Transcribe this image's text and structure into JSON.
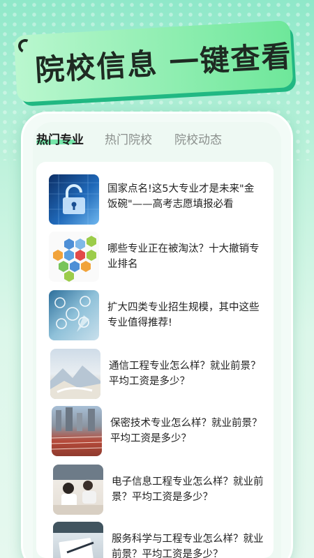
{
  "banner": {
    "title": "院校信息 一键查看"
  },
  "tabs": [
    {
      "label": "热门专业",
      "active": true
    },
    {
      "label": "热门院校",
      "active": false
    },
    {
      "label": "院校动态",
      "active": false
    }
  ],
  "articles": [
    {
      "title": "国家点名!这5大专业才是未来\"金饭碗\"——高考志愿填报必看",
      "thumb_icon": "padlock-cyber-image"
    },
    {
      "title": "哪些专业正在被淘汰？十大撤销专业排名",
      "thumb_icon": "hexagon-majors-image"
    },
    {
      "title": "扩大四类专业招生规模，其中这些专业值得推荐!",
      "thumb_icon": "tech-icons-image"
    },
    {
      "title": "通信工程专业怎么样？就业前景？平均工资是多少？",
      "thumb_icon": "mountain-landscape-image"
    },
    {
      "title": "保密技术专业怎么样？就业前景？平均工资是多少？",
      "thumb_icon": "stadium-track-image"
    },
    {
      "title": "电子信息工程专业怎么样？就业前景？平均工资是多少？",
      "thumb_icon": "students-classroom-image"
    },
    {
      "title": "服务科学与工程专业怎么样？就业前景？平均工资是多少？",
      "thumb_icon": "desk-notebook-image"
    }
  ],
  "colors": {
    "accent": "#5fe39b",
    "banner_dark": "#21b883"
  }
}
